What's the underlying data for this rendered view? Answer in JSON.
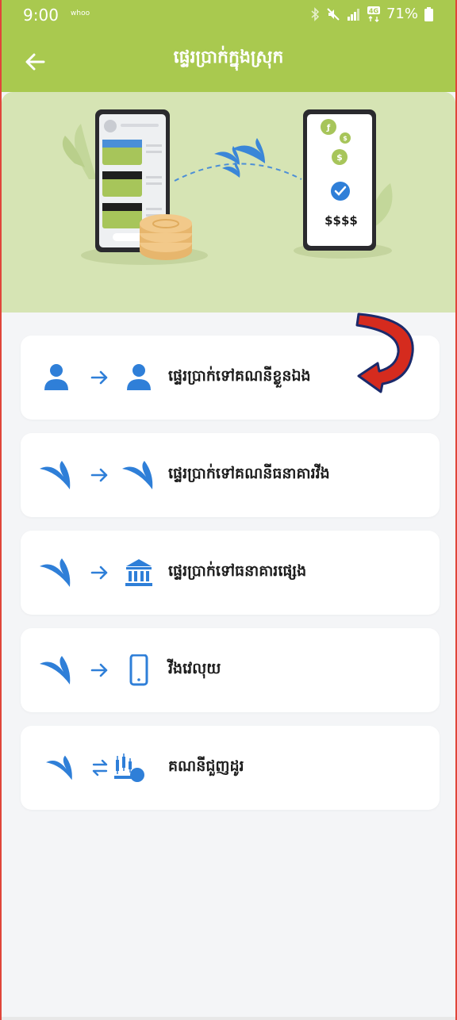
{
  "status_bar": {
    "time": "9:00",
    "carrier": "whoo",
    "battery": "71%",
    "icons": [
      "bluetooth-icon",
      "mute-icon",
      "signal-icon",
      "4g-icon",
      "battery-icon"
    ]
  },
  "header": {
    "title": "ផ្ទេរប្រាក់ក្នុងស្រុក",
    "back_icon": "back-arrow-icon"
  },
  "hero": {
    "amount_text": "$$$$"
  },
  "menu": {
    "items": [
      {
        "label": "ផ្ទេរប្រាក់ទៅគណនីខ្លួនឯង",
        "from_icon": "person-icon",
        "connector_icon": "arrow-right-icon",
        "to_icon": "person-icon"
      },
      {
        "label": "ផ្ទេរប្រាក់ទៅគណនីធនាគារវីង",
        "from_icon": "wing-bird-icon",
        "connector_icon": "arrow-right-icon",
        "to_icon": "wing-bird-icon"
      },
      {
        "label": "ផ្ទេរប្រាក់ទៅធនាគារផ្សេង",
        "from_icon": "wing-bird-icon",
        "connector_icon": "arrow-right-icon",
        "to_icon": "bank-icon"
      },
      {
        "label": "វីងវេលុយ",
        "from_icon": "wing-bird-icon",
        "connector_icon": "arrow-right-icon",
        "to_icon": "mobile-phone-icon"
      },
      {
        "label": "គណនីជួញដូរ",
        "from_icon": "wing-bird-icon",
        "connector_icon": "swap-arrows-icon",
        "to_icon": "trading-chart-icon"
      }
    ]
  },
  "colors": {
    "header_bg": "#a9c94f",
    "hero_bg": "#d6e4b4",
    "icon_blue": "#2f7fd8",
    "annotation_red": "#d52b1e"
  }
}
